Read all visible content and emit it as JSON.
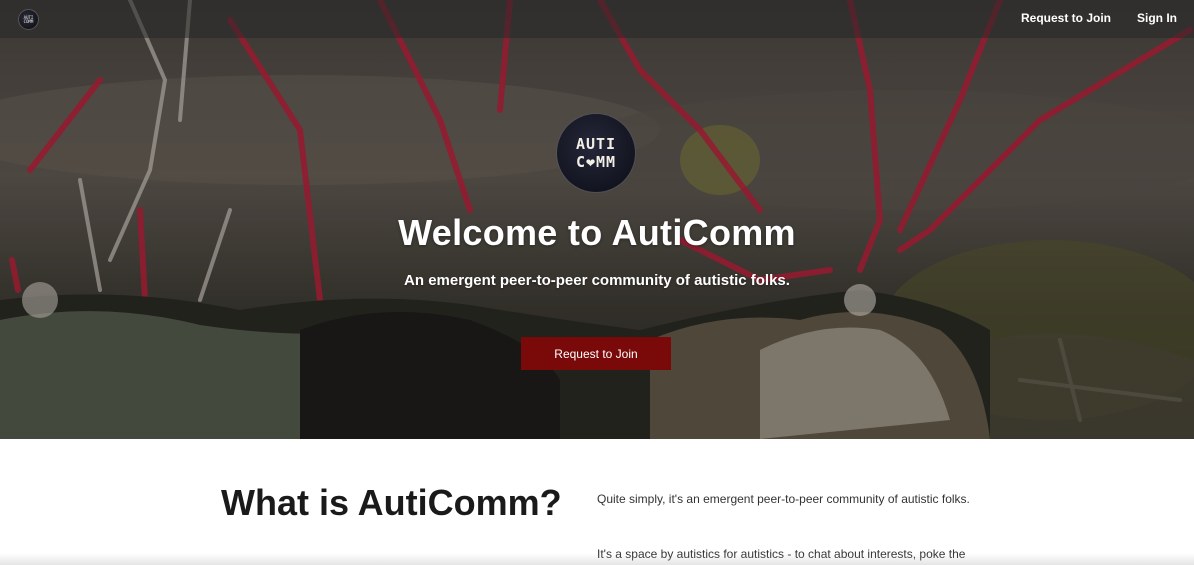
{
  "nav": {
    "logo_text_line1": "AUTI",
    "logo_text_line2": "COMM",
    "request_label": "Request to Join",
    "signin_label": "Sign In"
  },
  "hero": {
    "logo_line1": "AUTI",
    "logo_line2": "C❤MM",
    "title": "Welcome to AutiComm",
    "subtitle": "An emergent peer-to-peer community of autistic folks.",
    "button_label": "Request to Join",
    "accent_color": "#7a0a0a"
  },
  "about": {
    "heading": "What is AutiComm?",
    "paragraph1": "Quite simply, it's an emergent peer-to-peer community of autistic folks.",
    "paragraph2": "It's a space by autistics for autistics - to chat about interests, poke the"
  }
}
